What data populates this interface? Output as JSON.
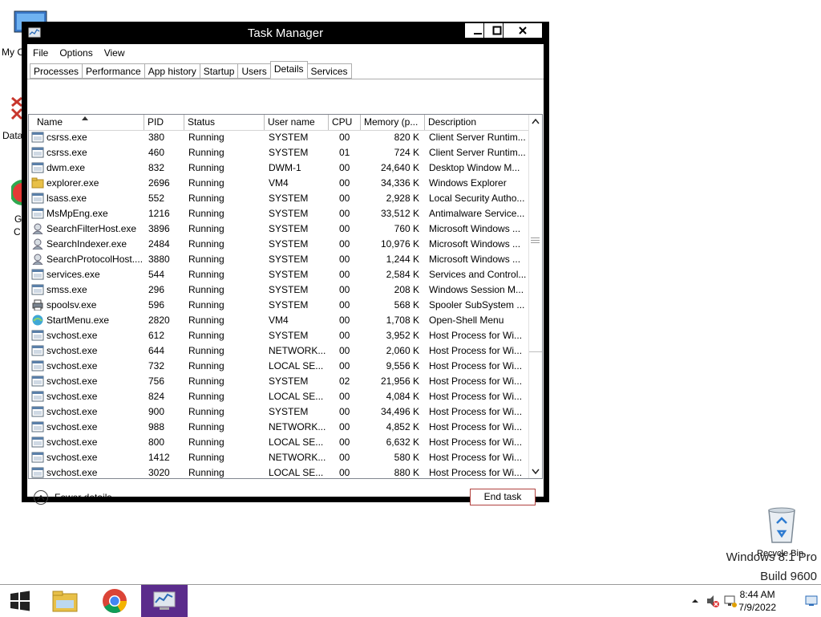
{
  "desktop": {
    "icons": [
      {
        "label": "My C",
        "icon": "computer-icon"
      },
      {
        "label": "Data",
        "icon": "data-icon"
      },
      {
        "label": "G",
        "icon": "chrome-icon"
      },
      {
        "label": "C",
        "icon": "chrome-icon"
      }
    ],
    "recycle_bin_label": "Recycle Bin",
    "watermark_line1": "Windows 8.1 Pro",
    "watermark_line2": "Build 9600"
  },
  "window": {
    "title": "Task Manager",
    "menu": [
      "File",
      "Options",
      "View"
    ],
    "tabs": [
      "Processes",
      "Performance",
      "App history",
      "Startup",
      "Users",
      "Details",
      "Services"
    ],
    "active_tab": "Details",
    "columns": [
      "Name",
      "PID",
      "Status",
      "User name",
      "CPU",
      "Memory (p...",
      "Description"
    ],
    "sort_column": "Name",
    "rows": [
      {
        "name": "csrss.exe",
        "pid": "380",
        "status": "Running",
        "user": "SYSTEM",
        "cpu": "00",
        "mem": "820 K",
        "desc": "Client Server Runtim...",
        "icon": "generic"
      },
      {
        "name": "csrss.exe",
        "pid": "460",
        "status": "Running",
        "user": "SYSTEM",
        "cpu": "01",
        "mem": "724 K",
        "desc": "Client Server Runtim...",
        "icon": "generic"
      },
      {
        "name": "dwm.exe",
        "pid": "832",
        "status": "Running",
        "user": "DWM-1",
        "cpu": "00",
        "mem": "24,640 K",
        "desc": "Desktop Window M...",
        "icon": "generic"
      },
      {
        "name": "explorer.exe",
        "pid": "2696",
        "status": "Running",
        "user": "VM4",
        "cpu": "00",
        "mem": "34,336 K",
        "desc": "Windows Explorer",
        "icon": "folder"
      },
      {
        "name": "lsass.exe",
        "pid": "552",
        "status": "Running",
        "user": "SYSTEM",
        "cpu": "00",
        "mem": "2,928 K",
        "desc": "Local Security Autho...",
        "icon": "generic"
      },
      {
        "name": "MsMpEng.exe",
        "pid": "1216",
        "status": "Running",
        "user": "SYSTEM",
        "cpu": "00",
        "mem": "33,512 K",
        "desc": "Antimalware Service...",
        "icon": "generic"
      },
      {
        "name": "SearchFilterHost.exe",
        "pid": "3896",
        "status": "Running",
        "user": "SYSTEM",
        "cpu": "00",
        "mem": "760 K",
        "desc": "Microsoft Windows ...",
        "icon": "search"
      },
      {
        "name": "SearchIndexer.exe",
        "pid": "2484",
        "status": "Running",
        "user": "SYSTEM",
        "cpu": "00",
        "mem": "10,976 K",
        "desc": "Microsoft Windows ...",
        "icon": "search"
      },
      {
        "name": "SearchProtocolHost....",
        "pid": "3880",
        "status": "Running",
        "user": "SYSTEM",
        "cpu": "00",
        "mem": "1,244 K",
        "desc": "Microsoft Windows ...",
        "icon": "search"
      },
      {
        "name": "services.exe",
        "pid": "544",
        "status": "Running",
        "user": "SYSTEM",
        "cpu": "00",
        "mem": "2,584 K",
        "desc": "Services and Control...",
        "icon": "generic"
      },
      {
        "name": "smss.exe",
        "pid": "296",
        "status": "Running",
        "user": "SYSTEM",
        "cpu": "00",
        "mem": "208 K",
        "desc": "Windows Session M...",
        "icon": "generic"
      },
      {
        "name": "spoolsv.exe",
        "pid": "596",
        "status": "Running",
        "user": "SYSTEM",
        "cpu": "00",
        "mem": "568 K",
        "desc": "Spooler SubSystem ...",
        "icon": "printer"
      },
      {
        "name": "StartMenu.exe",
        "pid": "2820",
        "status": "Running",
        "user": "VM4",
        "cpu": "00",
        "mem": "1,708 K",
        "desc": "Open-Shell Menu",
        "icon": "shell"
      },
      {
        "name": "svchost.exe",
        "pid": "612",
        "status": "Running",
        "user": "SYSTEM",
        "cpu": "00",
        "mem": "3,952 K",
        "desc": "Host Process for Wi...",
        "icon": "generic"
      },
      {
        "name": "svchost.exe",
        "pid": "644",
        "status": "Running",
        "user": "NETWORK...",
        "cpu": "00",
        "mem": "2,060 K",
        "desc": "Host Process for Wi...",
        "icon": "generic"
      },
      {
        "name": "svchost.exe",
        "pid": "732",
        "status": "Running",
        "user": "LOCAL SE...",
        "cpu": "00",
        "mem": "9,556 K",
        "desc": "Host Process for Wi...",
        "icon": "generic"
      },
      {
        "name": "svchost.exe",
        "pid": "756",
        "status": "Running",
        "user": "SYSTEM",
        "cpu": "02",
        "mem": "21,956 K",
        "desc": "Host Process for Wi...",
        "icon": "generic"
      },
      {
        "name": "svchost.exe",
        "pid": "824",
        "status": "Running",
        "user": "LOCAL SE...",
        "cpu": "00",
        "mem": "4,084 K",
        "desc": "Host Process for Wi...",
        "icon": "generic"
      },
      {
        "name": "svchost.exe",
        "pid": "900",
        "status": "Running",
        "user": "SYSTEM",
        "cpu": "00",
        "mem": "34,496 K",
        "desc": "Host Process for Wi...",
        "icon": "generic"
      },
      {
        "name": "svchost.exe",
        "pid": "988",
        "status": "Running",
        "user": "NETWORK...",
        "cpu": "00",
        "mem": "4,852 K",
        "desc": "Host Process for Wi...",
        "icon": "generic"
      },
      {
        "name": "svchost.exe",
        "pid": "800",
        "status": "Running",
        "user": "LOCAL SE...",
        "cpu": "00",
        "mem": "6,632 K",
        "desc": "Host Process for Wi...",
        "icon": "generic"
      },
      {
        "name": "svchost.exe",
        "pid": "1412",
        "status": "Running",
        "user": "NETWORK...",
        "cpu": "00",
        "mem": "580 K",
        "desc": "Host Process for Wi...",
        "icon": "generic"
      },
      {
        "name": "svchost.exe",
        "pid": "3020",
        "status": "Running",
        "user": "LOCAL SE...",
        "cpu": "00",
        "mem": "880 K",
        "desc": "Host Process for Wi...",
        "icon": "generic"
      }
    ],
    "fewer_details_label": "Fewer details",
    "end_task_label": "End task"
  },
  "taskbar": {
    "time": "8:44 AM",
    "date": "7/9/2022",
    "pinned": [
      "start-button",
      "file-explorer",
      "chrome",
      "task-manager"
    ],
    "active": "task-manager"
  },
  "colors": {
    "window_frame": "#000000",
    "taskbar_active": "#5b2c8c",
    "end_task_border": "#b0413e"
  }
}
